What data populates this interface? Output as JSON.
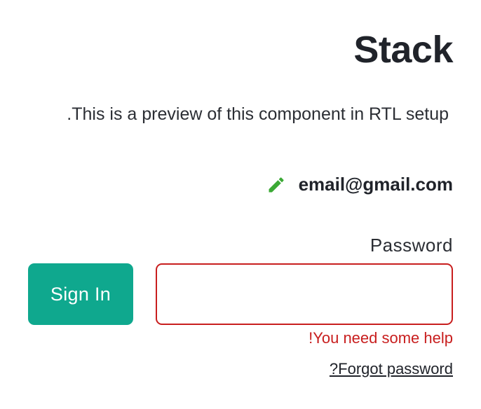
{
  "header": {
    "title": "Stack",
    "description": ".This is a preview of this component in RTL setup"
  },
  "account": {
    "email": "email@gmail.com",
    "edit_icon": "pencil-icon",
    "edit_icon_color": "#3ba935"
  },
  "form": {
    "password_label": "Password",
    "password_value": "",
    "password_border_color": "#c81e1e",
    "error_text": "!You need some help",
    "error_color": "#c81e1e",
    "forgot_link": "?Forgot password",
    "signin_label": "Sign In",
    "signin_color": "#0fa88e"
  }
}
